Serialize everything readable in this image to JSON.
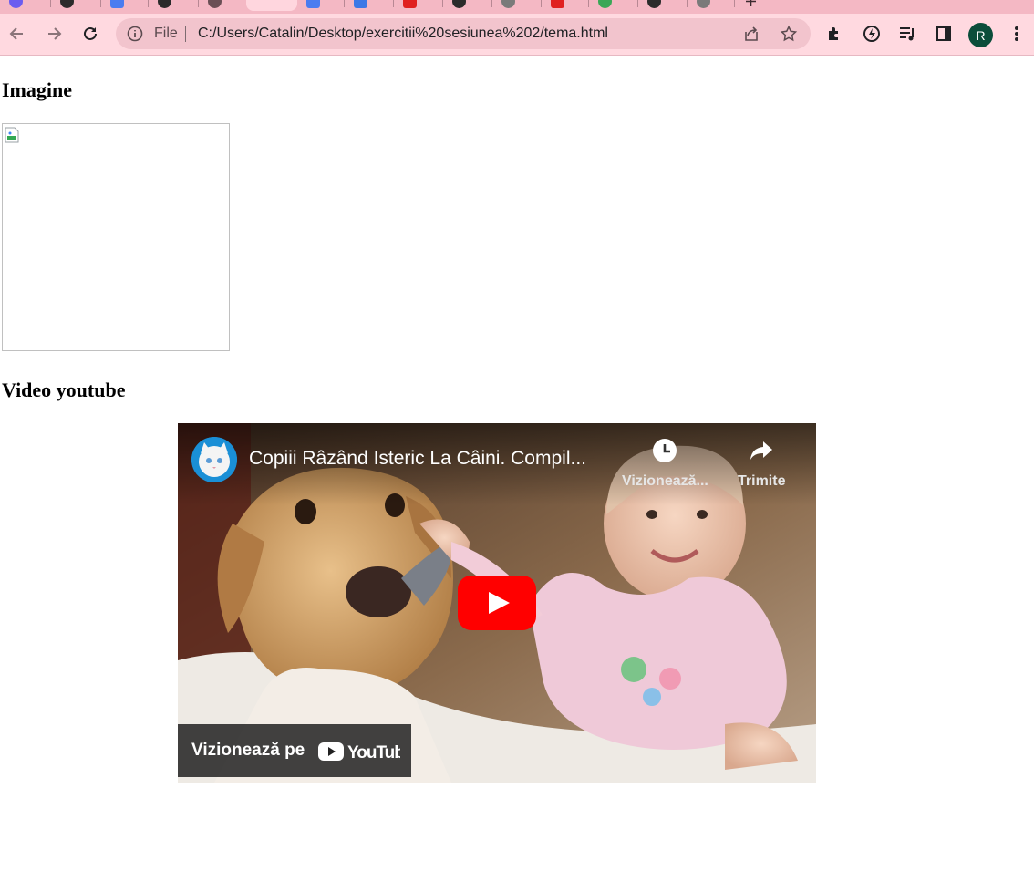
{
  "browser": {
    "address_label": "File",
    "url": "C:/Users/Catalin/Desktop/exercitii%20sesiunea%202/tema.html",
    "profile_initial": "R",
    "colors": {
      "tabstrip": "#f4b8c4",
      "toolbar": "#ffd9e0",
      "omnibox": "#f2c4cd",
      "avatar": "#0b4d3a"
    }
  },
  "page": {
    "heading_image": "Imagine",
    "heading_video": "Video youtube"
  },
  "video": {
    "title": "Copiii Râzând Isteric La Câini. Compil...",
    "watch_later_label": "Vizionează...",
    "share_label": "Trimite",
    "watch_on_label": "Vizionează pe",
    "platform": "YouTube",
    "colors": {
      "play": "#ff0000"
    }
  }
}
